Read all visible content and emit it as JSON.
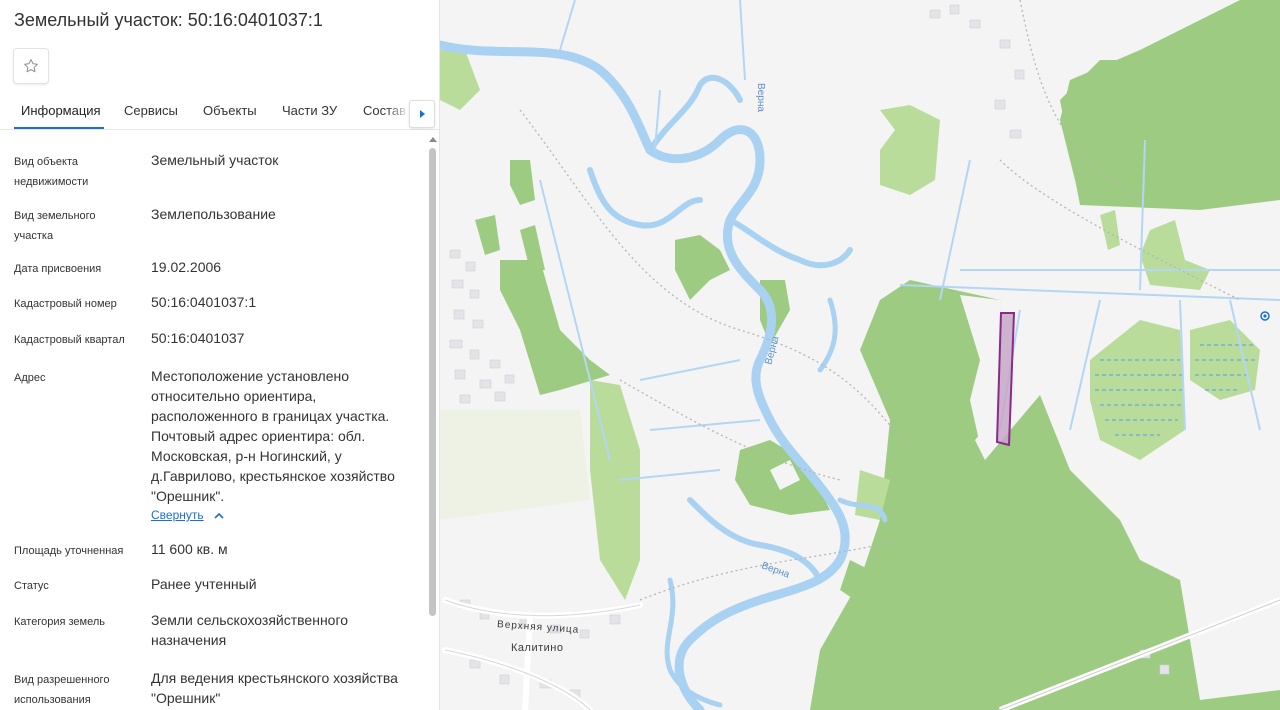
{
  "header": {
    "title": "Земельный участок: 50:16:0401037:1",
    "favorite_icon": "star-outline-icon"
  },
  "tabs": [
    {
      "label": "Информация",
      "active": true
    },
    {
      "label": "Сервисы"
    },
    {
      "label": "Объекты"
    },
    {
      "label": "Части ЗУ"
    },
    {
      "label": "Состав"
    }
  ],
  "tabs_scroll_icon": "chevron-right-icon",
  "info": {
    "rows": [
      {
        "label": "Вид объекта недвижимости",
        "value": "Земельный участок"
      },
      {
        "label": "Вид земельного участка",
        "value": "Землепользование"
      },
      {
        "label": "Дата присвоения",
        "value": "19.02.2006"
      },
      {
        "label": "Кадастровый номер",
        "value": "50:16:0401037:1"
      },
      {
        "label": "Кадастровый квартал",
        "value": "50:16:0401037"
      },
      {
        "label": "Адрес",
        "value": "Местоположение установлено относительно ориентира, расположенного в границах участка. Почтовый адрес ориентира: обл. Московская, р-н Ногинский, у д.Гаврилово, крестьянское хозяйство \"Орешник\"."
      },
      {
        "label": "Площадь уточненная",
        "value": "11 600 кв. м"
      },
      {
        "label": "Статус",
        "value": "Ранее учтенный"
      },
      {
        "label": "Категория земель",
        "value": "Земли сельскохозяйственного назначения"
      },
      {
        "label": "Вид разрешенного использования",
        "value": "Для ведения крестьянского хозяйства \"Орешник\""
      }
    ],
    "collapse_label": "Свернуть"
  },
  "map": {
    "labels": {
      "river1": "Верна",
      "river2": "Верна",
      "river3": "Верна",
      "street": "Верхняя улица",
      "village": "Калитино"
    },
    "colors": {
      "forest": "#9ecb82",
      "light_forest": "#b9dc9b",
      "water": "#a9d1f2",
      "parcel": "#8b2a8b"
    }
  }
}
